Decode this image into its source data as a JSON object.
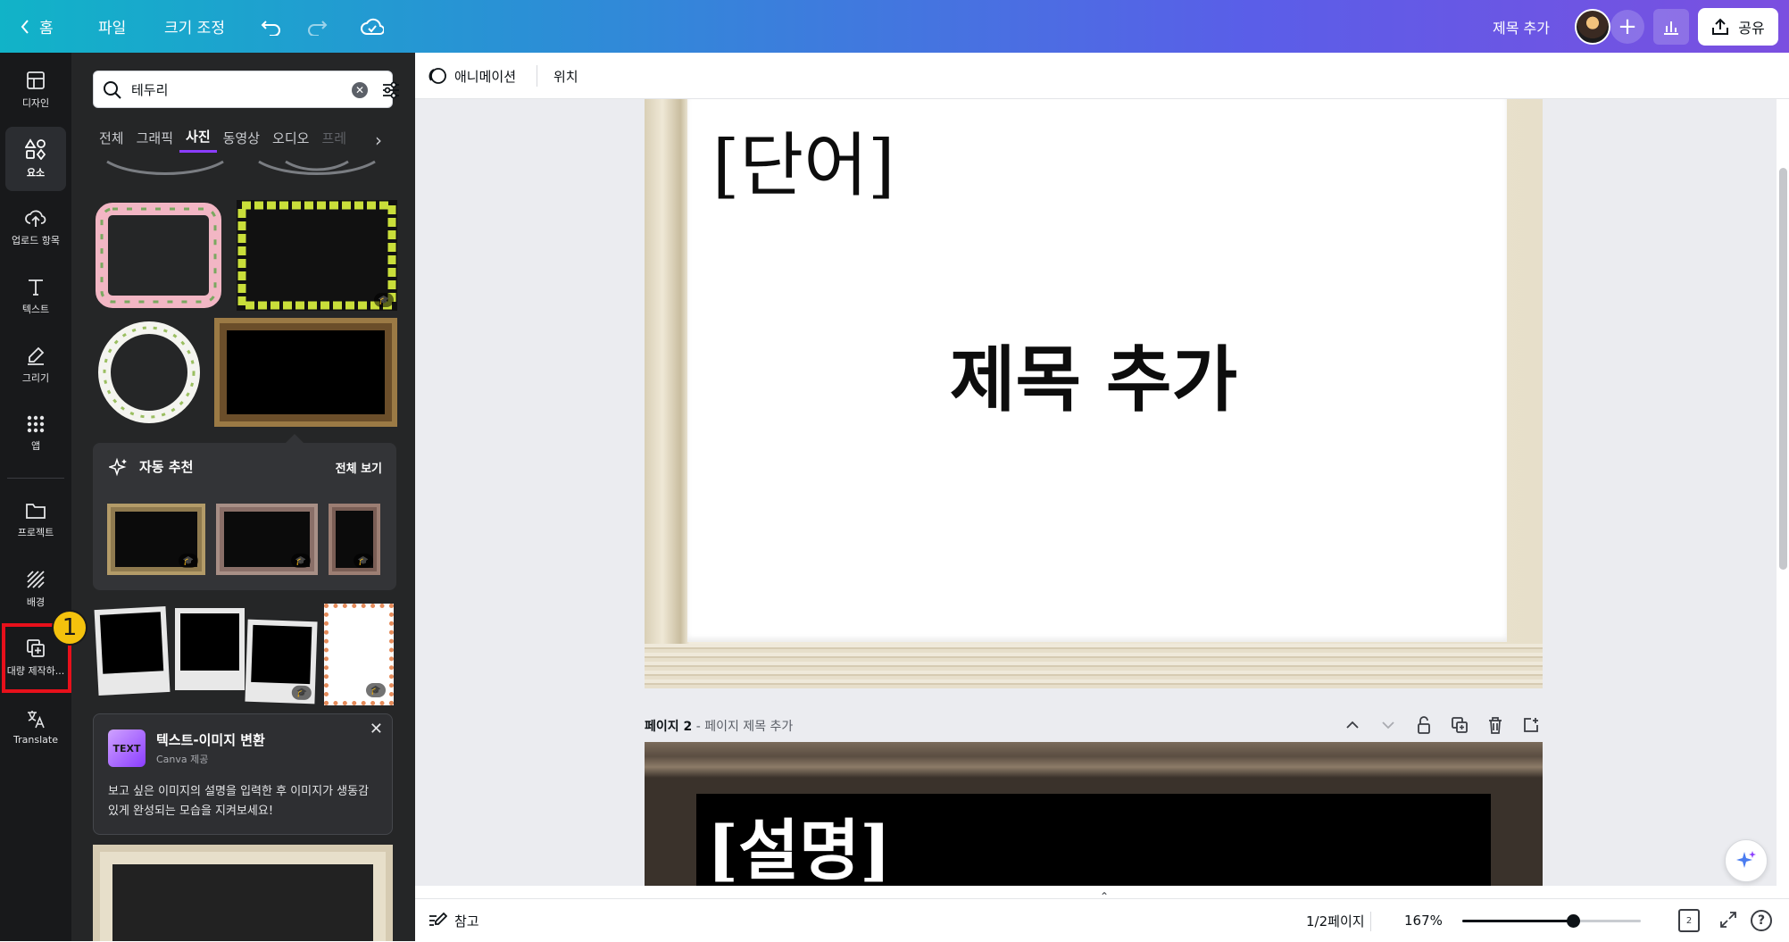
{
  "topbar": {
    "home_label": "홈",
    "file_label": "파일",
    "resize_label": "크기 조정",
    "doc_title": "제목 추가",
    "share_label": "공유",
    "plus_label": "+"
  },
  "rail": {
    "items": [
      {
        "label": "디자인",
        "icon": "layout-icon"
      },
      {
        "label": "요소",
        "icon": "shapes-icon"
      },
      {
        "label": "업로드 항목",
        "icon": "cloud-upload-icon"
      },
      {
        "label": "텍스트",
        "icon": "text-icon"
      },
      {
        "label": "그리기",
        "icon": "draw-icon"
      },
      {
        "label": "앱",
        "icon": "apps-grid-icon"
      },
      {
        "label": "프로젝트",
        "icon": "folder-icon"
      },
      {
        "label": "배경",
        "icon": "background-pattern-icon"
      },
      {
        "label": "대량 제작하...",
        "icon": "bulk-create-icon"
      },
      {
        "label": "Translate",
        "icon": "translate-icon"
      }
    ],
    "active_item": "요소"
  },
  "callout": {
    "number": "1"
  },
  "panel": {
    "search_value": "테두리",
    "tabs": [
      "전체",
      "그래픽",
      "사진",
      "동영상",
      "오디오",
      "프레"
    ],
    "active_tab": "사진",
    "suggest": {
      "title": "자동 추천",
      "see_all": "전체 보기"
    },
    "promo": {
      "icon_text": "TEXT",
      "title": "텍스트-이미지 변환",
      "subtitle": "Canva 제공",
      "body": "보고 싶은 이미지의 설명을 입력한 후 이미지가 생동감 있게 완성되는 모습을 지켜보세요!",
      "close": "✕"
    },
    "premium_badge": "🎓"
  },
  "context_toolbar": {
    "animate_label": "애니메이션",
    "position_label": "위치"
  },
  "canvas": {
    "page1": {
      "word_text": "[단어]",
      "title_text": "제목 추가"
    },
    "page2": {
      "label_bold": "페이지 2",
      "label_rest": " - 페이지 제목 추가",
      "desc_text": "[설명]"
    }
  },
  "bottombar": {
    "notes_label": "참고",
    "page_count": "1/2페이지",
    "zoom": "167%",
    "zoom_fraction": 0.62,
    "grid_pages": "2",
    "help": "?"
  },
  "colors": {
    "accent": "#8b3dff",
    "highlight_box": "#e8101b",
    "callout": "#f4c20d"
  }
}
